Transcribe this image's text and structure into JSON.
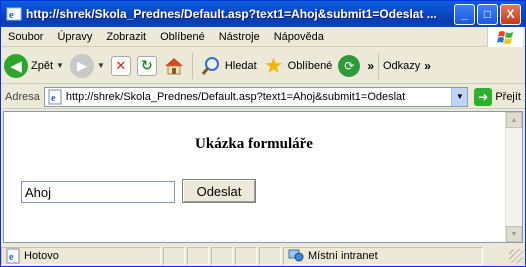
{
  "window": {
    "title": "http://shrek/Skola_Prednes/Default.asp?text1=Ahoj&submit1=Odeslat ...",
    "minimize": "_",
    "maximize": "□",
    "close": "X"
  },
  "menu": {
    "items": [
      {
        "label": "Soubor"
      },
      {
        "label": "Úpravy"
      },
      {
        "label": "Zobrazit"
      },
      {
        "label": "Oblíbené"
      },
      {
        "label": "Nástroje"
      },
      {
        "label": "Nápověda"
      }
    ]
  },
  "toolbar": {
    "back": "Zpět",
    "search": "Hledat",
    "favorites": "Oblíbené",
    "more": "»",
    "links": "Odkazy",
    "links_more": "»"
  },
  "address": {
    "label": "Adresa",
    "url": "http://shrek/Skola_Prednes/Default.asp?text1=Ahoj&submit1=Odeslat",
    "go": "Přejít"
  },
  "page": {
    "heading": "Ukázka formuláře",
    "input_value": "Ahoj",
    "button_label": "Odeslat"
  },
  "status": {
    "text": "Hotovo",
    "zone": "Místní intranet"
  },
  "colors": {
    "titlebar": "#0a4ac8",
    "chrome": "#ece9d8"
  }
}
